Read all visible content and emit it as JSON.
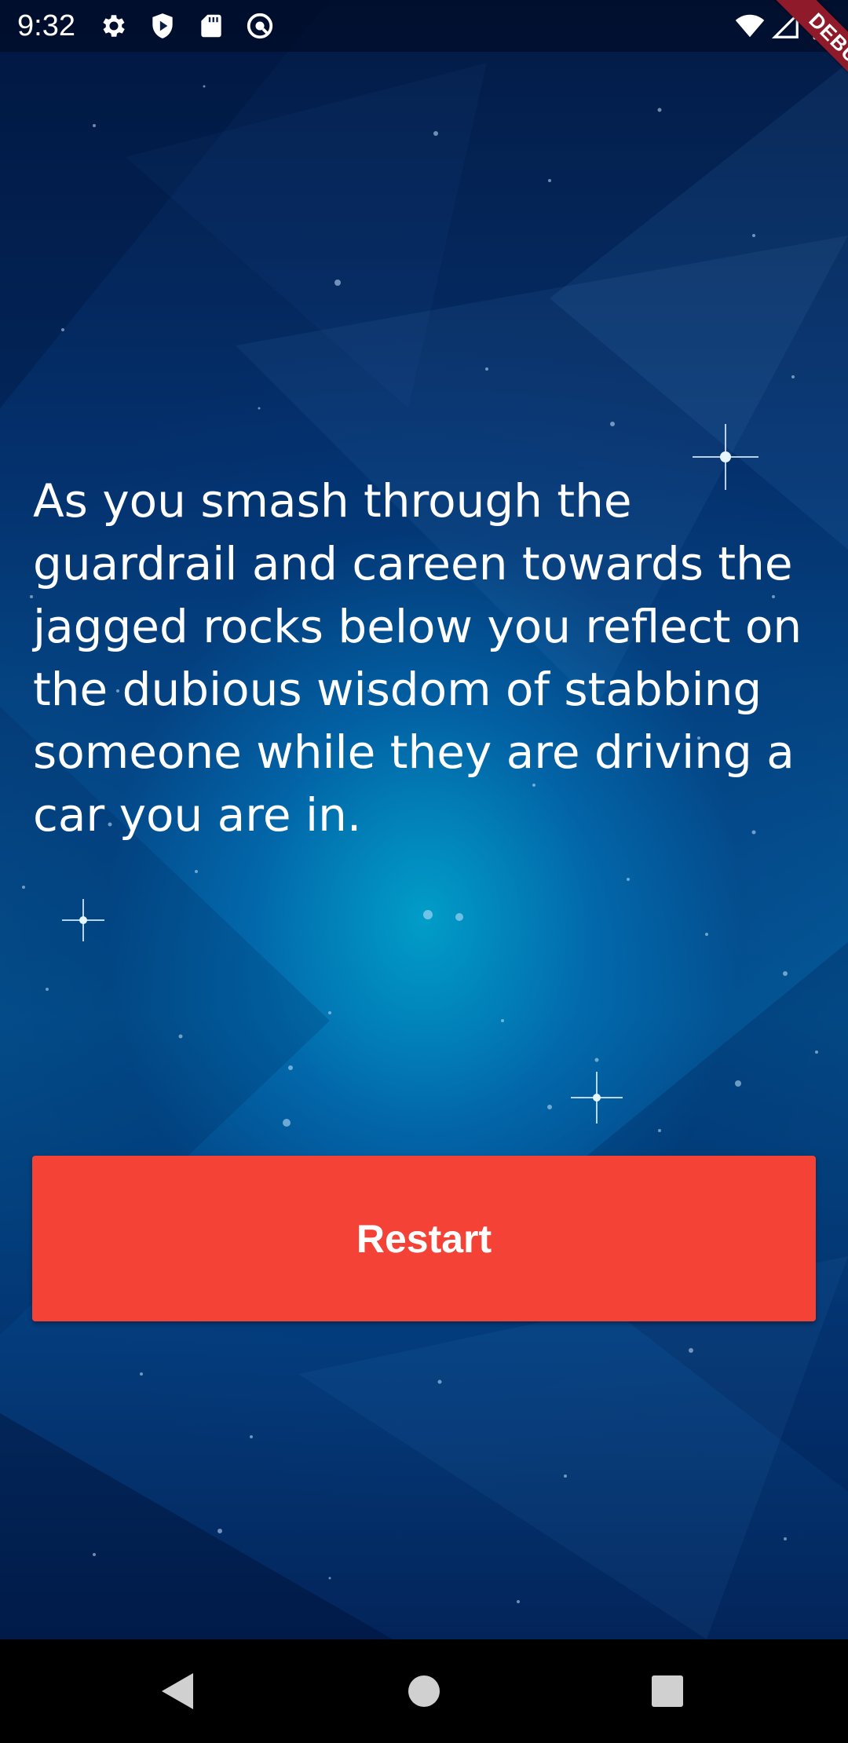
{
  "status_bar": {
    "time": "9:32",
    "left_icons": [
      "settings-icon",
      "play-protect-icon",
      "sd-card-icon",
      "vpn-key-icon"
    ],
    "right_icons": [
      "wifi-icon",
      "cell-signal-icon",
      "battery-icon"
    ]
  },
  "debug_banner": {
    "label": "DEBUG",
    "color": "#8e1a2a"
  },
  "story": {
    "text": "As you smash through the guardrail and careen towards the jagged rocks below you reflect on the dubious wisdom of stabbing someone while they are driving a car you are in."
  },
  "restart_button": {
    "label": "Restart",
    "color": "#f44336"
  },
  "nav_bar": {
    "buttons": [
      "back-icon",
      "home-icon",
      "recents-icon"
    ]
  },
  "colors": {
    "background_top": "#031a44",
    "background_center": "#00aad2",
    "text": "#ffffff"
  }
}
